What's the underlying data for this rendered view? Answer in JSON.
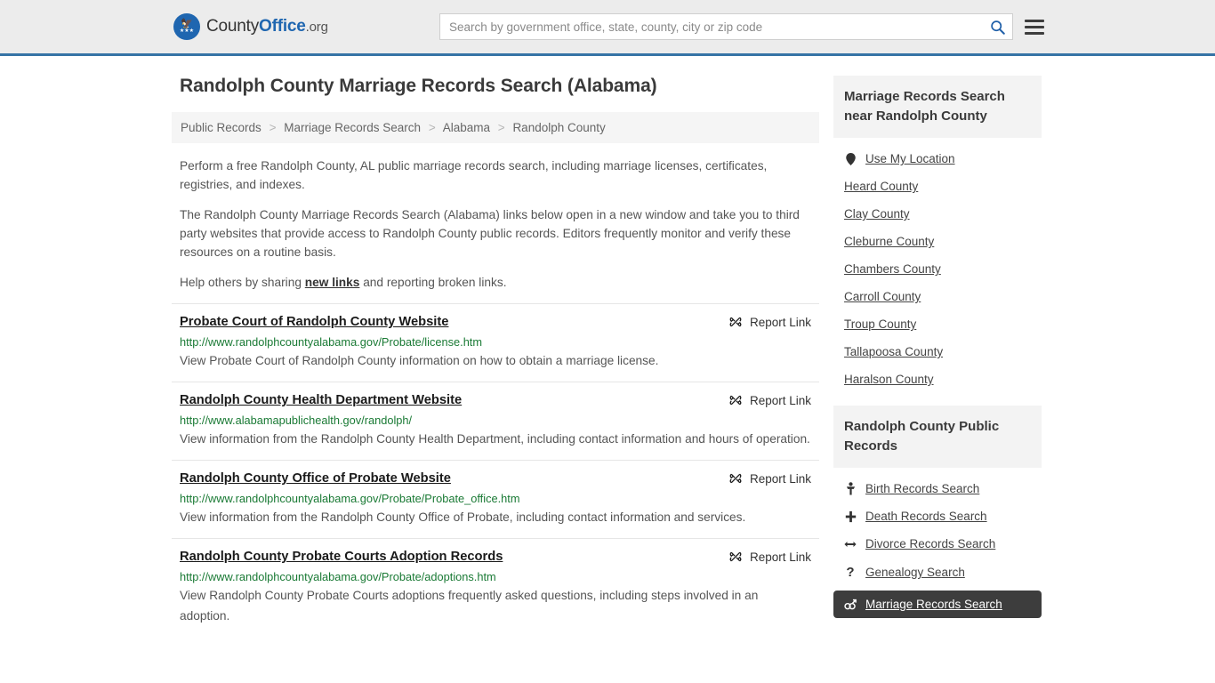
{
  "header": {
    "logo": {
      "name_part1": "County",
      "name_part2": "Office",
      "name_part3": ".org",
      "icon": "eagle-seal-icon"
    },
    "search": {
      "placeholder": "Search by government office, state, county, city or zip code",
      "value": "",
      "button_icon": "search-icon"
    },
    "menu_icon": "hamburger-menu-icon",
    "accent_color": "#3573a5"
  },
  "main": {
    "title": "Randolph County Marriage Records Search (Alabama)",
    "breadcrumb": [
      {
        "label": "Public Records",
        "current": false
      },
      {
        "label": "Marriage Records Search",
        "current": false
      },
      {
        "label": "Alabama",
        "current": false
      },
      {
        "label": "Randolph County",
        "current": true
      }
    ],
    "breadcrumb_separator": ">",
    "intro": {
      "p1": "Perform a free Randolph County, AL public marriage records search, including marriage licenses, certificates, registries, and indexes.",
      "p2": "The Randolph County Marriage Records Search (Alabama) links below open in a new window and take you to third party websites that provide access to Randolph County public records. Editors frequently monitor and verify these resources on a routine basis.",
      "p3_before": "Help others by sharing ",
      "p3_link": "new links",
      "p3_after": " and reporting broken links."
    },
    "report_link_label": "Report Link",
    "report_link_icon": "broken-link-icon",
    "results": [
      {
        "title": "Probate Court of Randolph County Website",
        "url": "http://www.randolphcountyalabama.gov/Probate/license.htm",
        "description": "View Probate Court of Randolph County information on how to obtain a marriage license."
      },
      {
        "title": "Randolph County Health Department Website",
        "url": "http://www.alabamapublichealth.gov/randolph/",
        "description": "View information from the Randolph County Health Department, including contact information and hours of operation."
      },
      {
        "title": "Randolph County Office of Probate Website",
        "url": "http://www.randolphcountyalabama.gov/Probate/Probate_office.htm",
        "description": "View information from the Randolph County Office of Probate, including contact information and services."
      },
      {
        "title": "Randolph County Probate Courts Adoption Records",
        "url": "http://www.randolphcountyalabama.gov/Probate/adoptions.htm",
        "description": "View Randolph County Probate Courts adoptions frequently asked questions, including steps involved in an adoption."
      }
    ]
  },
  "sidebar": {
    "nearby": {
      "heading": "Marriage Records Search near Randolph County",
      "items": [
        {
          "label": "Use My Location",
          "icon": "map-pin-icon"
        },
        {
          "label": "Heard County",
          "icon": ""
        },
        {
          "label": "Clay County",
          "icon": ""
        },
        {
          "label": "Cleburne County",
          "icon": ""
        },
        {
          "label": "Chambers County",
          "icon": ""
        },
        {
          "label": "Carroll County",
          "icon": ""
        },
        {
          "label": "Troup County",
          "icon": ""
        },
        {
          "label": "Tallapoosa County",
          "icon": ""
        },
        {
          "label": "Haralson County",
          "icon": ""
        }
      ]
    },
    "public_records": {
      "heading": "Randolph County Public Records",
      "items": [
        {
          "label": "Birth Records Search",
          "icon": "baby-icon",
          "active": false
        },
        {
          "label": "Death Records Search",
          "icon": "cross-icon",
          "active": false
        },
        {
          "label": "Divorce Records Search",
          "icon": "left-right-arrow-icon",
          "active": false
        },
        {
          "label": "Genealogy Search",
          "icon": "question-mark-icon",
          "active": false
        },
        {
          "label": "Marriage Records Search",
          "icon": "gender-symbols-icon",
          "active": true
        }
      ]
    }
  }
}
